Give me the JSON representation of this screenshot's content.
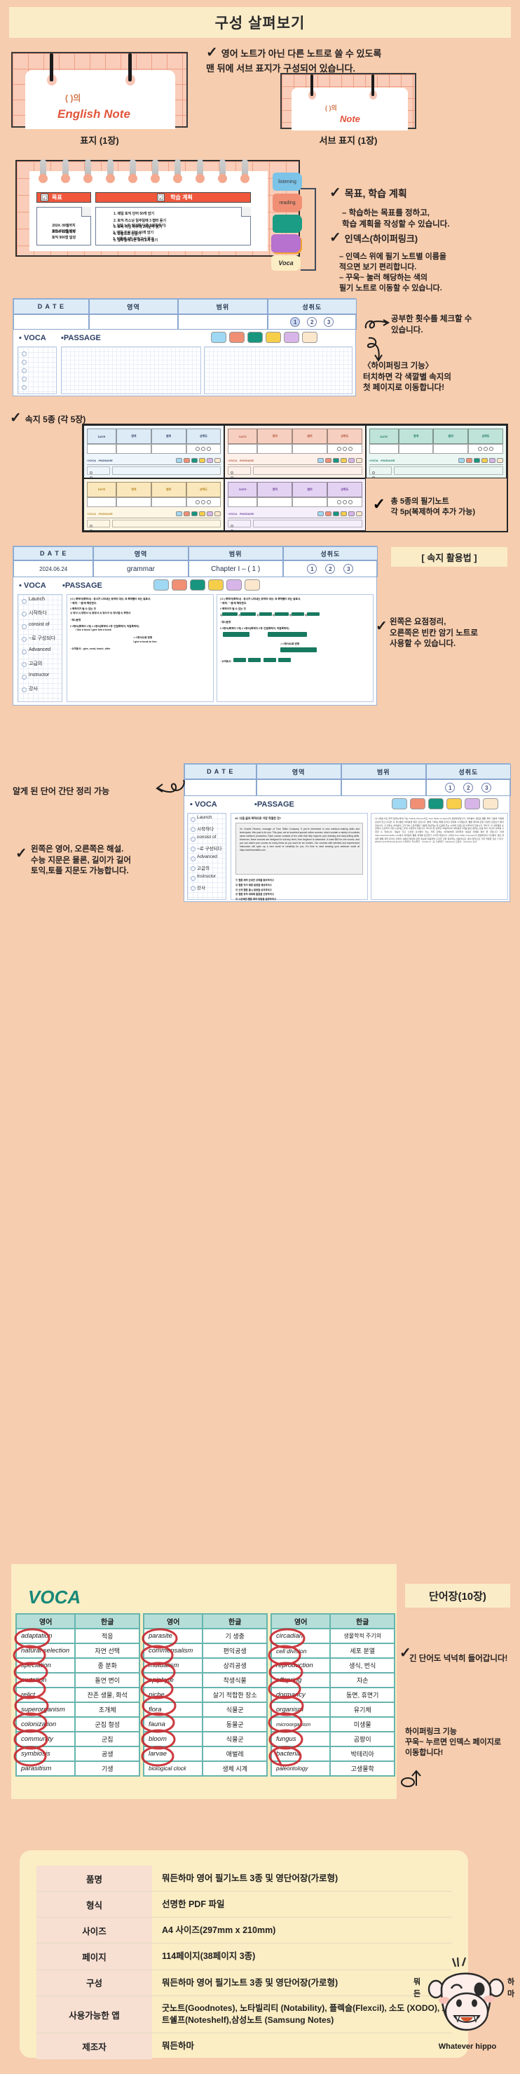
{
  "header": {
    "title": "구성 살펴보기"
  },
  "cover_section": {
    "note": "영어 노트가 아닌 다른 노트로 쓸 수 있도록\n맨 뒤에 서브 표지가 구성되어 있습니다.",
    "check_icon": "check-icon",
    "main_cover": {
      "paren": "(          )의",
      "title": "English Note",
      "caption": "표지 (1장)"
    },
    "sub_cover": {
      "paren": "(        )의",
      "title": "Note",
      "caption": "서브 표지 (1장)"
    }
  },
  "goal_section": {
    "tab_goal": "목표",
    "tab_plan": "학습 계획",
    "checkbox_glyph": "☑",
    "memo1_date": "2024. 09월까지\n토익 800점 달성",
    "memo2_date": "2024. 12월까지\n토익 900점 달성",
    "plan_list_1": [
      "1.    매일 토익 단어 50개 암기",
      "2.    토익 리스닝 일주일에 3 챕터 듣기",
      "3.    토익 리딩 하루에 2지문씩 읽기",
      "4.    오답노트 만들기",
      "5.    일주일에 1번 모의고사 풀기"
    ],
    "plan_list_2": [
      "1.    오답 노트 암기하기(총 3회독하기)",
      "2.    매일 토익 단어 50개 암기",
      "3.    이틀에 1번 모의고사 풀기"
    ],
    "index_tabs": [
      {
        "label": "listening",
        "color": "#7cc3e8"
      },
      {
        "label": "reading",
        "color": "#f08f74"
      },
      {
        "label": "",
        "color": "#1b9c84"
      },
      {
        "label": "",
        "color": "#f5a42b"
      },
      {
        "label": "",
        "color": "#b771cf"
      },
      {
        "label": "Voca",
        "color": "#fbedc4"
      }
    ],
    "note_goal_title": "목표, 학습 계획",
    "note_goal_body": "– 학습하는 목표를 정하고,\n학습 계획을 작성할 수 있습니다.",
    "note_index_title": "인덱스(하이퍼링크)",
    "note_index_body": "– 인덱스 위에 필기 노트별 이름을\n적으면 보기 편리합니다.\n– 꾸욱~ 눌러 해당하는 색의\n필기 노트로 이동할 수 있습니다."
  },
  "sheet_section": {
    "headers": [
      "D A T E",
      "영역",
      "범위",
      "성취도"
    ],
    "circles": [
      "1",
      "2",
      "3"
    ],
    "voca_label": "▪ VOCA",
    "passage_label": "▪PASSAGE",
    "swatch_colors": [
      "#9fd8f2",
      "#f08f74",
      "#17957e",
      "#f6ce4a",
      "#d7b5e8",
      "#fbe7cc"
    ],
    "note_count": "공부한 횟수를 체크할 수\n있습니다.",
    "note_hyperlink": "〈하이퍼링크 기능〉\n터치하면 각 색깔별 속지의\n첫 페이지로 이동합니다!",
    "label_5types": "속지 5종 (각 5장)",
    "note_total": "총 5종의 필기노트\n각 5p(복제하여 추가 가능)",
    "thumb_colors": [
      "#eef5fb",
      "#fdf0e9",
      "#eaf6f2",
      "#fdf6e4",
      "#f5eefb"
    ],
    "thumb_head_colors": [
      "#ddebf7",
      "#f6cfc0",
      "#bfe3d8",
      "#fae7bb",
      "#e3d2f2"
    ],
    "thumb_text_colors": [
      "#2c3f63",
      "#b4553c",
      "#1b7a65",
      "#b5841f",
      "#6d3f9c"
    ]
  },
  "usage_section": {
    "badge": "[ 속지 활용법 ]",
    "headers": [
      "D A T E",
      "영역",
      "범위",
      "성취도"
    ],
    "row": {
      "date": "2024.06.24",
      "area": "grammar",
      "range": "Chapter I – ( 1 )"
    },
    "circles": [
      "1",
      "2",
      "3"
    ],
    "voca_label": "▪ VOCA",
    "passage_label": "▪PASSAGE",
    "voca_words": [
      "Launch",
      "시작하다",
      "consist of",
      "~로 구성되다",
      "Advanced",
      "고급의",
      "Instructor",
      "강사"
    ],
    "left_lines": [
      "( D ) 목적어(목적사) : 동사가 나타내는 동작의 대상, 즉 목적물이 되는 말로서,",
      "'~에게', '~을'에 해당한다.",
      "# 목적어가 될 수 있는 것",
      "1) 명사  2) 대명사  3) 동명사  4) 명사구  5) 명사절  6) 부정사",
      "·  예시문장",
      "# 3형식(목적어 1개)                    # 4형식(목적어 2개~간접목적어, 직접목적어)",
      "I like a book                              I give him a book",
      "-> 3형식으로 변형",
      "I give a book to him",
      "·  수여동사 : give, send, teach, offer"
    ],
    "note_left_right": "왼쪽은 요점정리,\n오른쪽은 빈칸 암기 노트로\n사용할 수 있습니다.",
    "note_words": "알게 된 단어 간단 정리 가능",
    "note_passage": "왼쪽은 영어, 오른쪽은 해설.\n수능 지문은 물론, 길이가 길어\n토익,토플 지문도 가능합니다.",
    "passage_q": "16.  다음 글의 목적으로 가장 적절한 것?",
    "passage_body": "I'm Charlie Reeves, manager of Toon Skills Company. If you're interested in new webtoon-making skills and techniques, this post is for you. This year, we've launched special online courses, which contain a variety of contents about webtoon production. Each course consists of ten units that help improve your drawing and story-telling skills. Moreover, these courses are designed to suit any level, from beginner to advanced. It costs $45 for one course, and you can watch your course as many times as you want for six months. Our courses with talented and experienced instructors will open up a new world of creativity for you. It's time to start creating your webtoon world at https://webtoonskills.com.",
    "passage_choices": [
      "① 웹툰 제작 온라인 강좌를 홍보하려고",
      "② 웹툰 작가 채용 일정을 재공하려고",
      "③ 신작 웹툰 출시 일정을 공지하려고",
      "④ 웹툰 창작 대회에 출품을 신청하려고",
      "⑤ 시즌제인 웹툰 제작 방법을 설명하려고"
    ]
  },
  "voca_section": {
    "title": "VOCA",
    "tag": "단어장(10장)",
    "col_headers": [
      "영어",
      "한글"
    ],
    "columns": [
      [
        [
          "adaptation",
          "적응"
        ],
        [
          "natural selection",
          "자연 선택"
        ],
        [
          "speciation",
          "종 분화"
        ],
        [
          "mutation",
          "돌연 변이"
        ],
        [
          "relict",
          "잔존 생물, 화석"
        ],
        [
          "superorganism",
          "초개체"
        ],
        [
          "colonization",
          "군집 형성"
        ],
        [
          "community",
          "군집"
        ],
        [
          "symbiosis",
          "공생"
        ],
        [
          "parasitism",
          "기생"
        ]
      ],
      [
        [
          "parasite",
          "기 생충"
        ],
        [
          "commensalism",
          "편익공생"
        ],
        [
          "mutualism",
          "상리공생"
        ],
        [
          "epiphyte",
          "착생식물"
        ],
        [
          "niche",
          "살기 적합한 장소"
        ],
        [
          "flora",
          "식물군"
        ],
        [
          "fauna",
          "동물군"
        ],
        [
          "bloom",
          "식물군"
        ],
        [
          "larvae",
          "애벌레"
        ],
        [
          "biological clock",
          "생체 시계"
        ]
      ],
      [
        [
          "circadian",
          "생물학적 주기의"
        ],
        [
          "cell division",
          "세포 분열"
        ],
        [
          "reproduction",
          "생식, 번식"
        ],
        [
          "offspring",
          "자손"
        ],
        [
          "dormancy",
          "동면, 휴면기"
        ],
        [
          "organism",
          "유기체"
        ],
        [
          "microorganism",
          "미생물"
        ],
        [
          "fungus",
          "곰팡이"
        ],
        [
          "bacteria",
          "박테리아"
        ],
        [
          "paleontology",
          "고생물학"
        ]
      ]
    ],
    "note_long_word": "긴 단어도 넉넉히 들어갑니다!",
    "note_hyperlink": "하이퍼링크 기능\n꾸욱~ 누르면 인덱스 페이지로\n이동합니다!"
  },
  "spec": {
    "rows": [
      {
        "key": "품명",
        "value": "뭐든하마 영어 필기노트 3종 및 영단어장(가로형)"
      },
      {
        "key": "형식",
        "value": "선명한 PDF 파일"
      },
      {
        "key": "사이즈",
        "value": "A4 사이즈(297mm x 210mm)"
      },
      {
        "key": "페이지",
        "value": "114페이지(38페이지 3종)"
      },
      {
        "key": "구성",
        "value": "뭐든하마 영어 필기노트 3종 및 영단어장(가로형)"
      },
      {
        "key": "사용가능한 앱",
        "value": "굿노트(Goodnotes), 노타빌리티 (Notability), 플렉슬(Flexcil), 소도 (XODO), 노트쉘프(Noteshelf),삼성노트 (Samsung Notes)"
      },
      {
        "key": "제조자",
        "value": "뭐든하마"
      }
    ]
  },
  "mascot": {
    "caption": "Whatever hippo",
    "bubble_left": "뭐\n든",
    "bubble_right": "하\n마"
  },
  "colors": {
    "page_bg": "#f6cdae",
    "banner_bg": "#fbecc8",
    "accent_red": "#f0573c",
    "accent_teal": "#178878"
  }
}
